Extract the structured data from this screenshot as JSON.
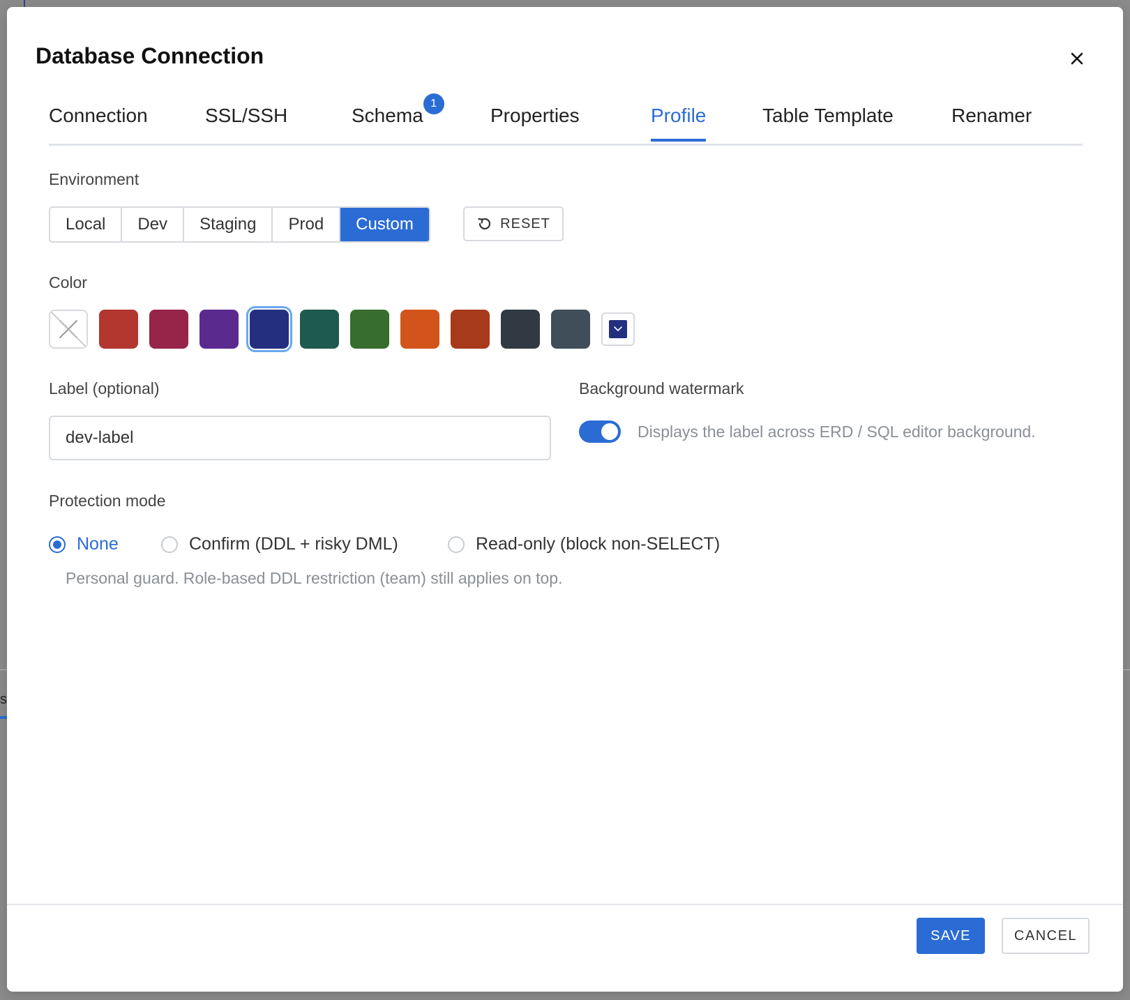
{
  "dialog": {
    "title": "Database Connection",
    "close_icon": "close-icon"
  },
  "tabs": [
    {
      "label": "Connection",
      "active": false
    },
    {
      "label": "SSL/SSH",
      "active": false
    },
    {
      "label": "Schema",
      "active": false,
      "badge": "1"
    },
    {
      "label": "Properties",
      "active": false
    },
    {
      "label": "Profile",
      "active": true
    },
    {
      "label": "Table Template",
      "active": false
    },
    {
      "label": "Renamer",
      "active": false
    }
  ],
  "environment": {
    "label": "Environment",
    "options": [
      "Local",
      "Dev",
      "Staging",
      "Prod",
      "Custom"
    ],
    "selected": "Custom",
    "reset_label": "RESET",
    "reset_icon": "reset-icon"
  },
  "color": {
    "label": "Color",
    "swatches": [
      "none",
      "#b3362f",
      "#962549",
      "#5b2a8f",
      "#24307f",
      "#1f5a4f",
      "#376e2d",
      "#d2541a",
      "#a63a1b",
      "#313a42",
      "#3f4e59"
    ],
    "selected_index": 4,
    "custom_color": "#24307f"
  },
  "label_field": {
    "label": "Label (optional)",
    "value": "dev-label"
  },
  "watermark": {
    "label": "Background watermark",
    "enabled": true,
    "description": "Displays the label across ERD / SQL editor background."
  },
  "protection": {
    "label": "Protection mode",
    "options": [
      "None",
      "Confirm (DDL + risky DML)",
      "Read-only (block non-SELECT)"
    ],
    "selected": "None",
    "hint": "Personal guard. Role-based DDL restriction (team) still applies on top."
  },
  "footer": {
    "save_label": "SAVE",
    "cancel_label": "CANCEL"
  },
  "colors": {
    "accent": "#2b6cd4"
  }
}
